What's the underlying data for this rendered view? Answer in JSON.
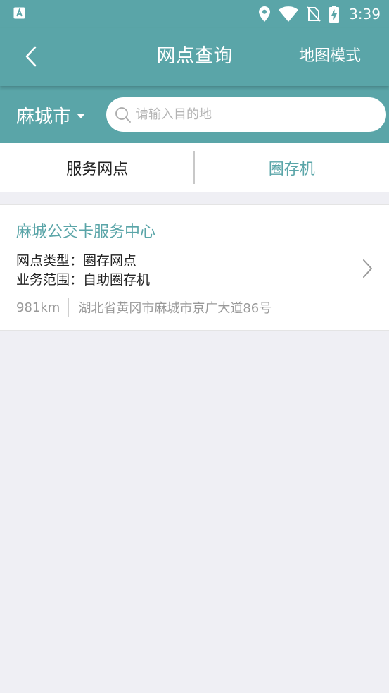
{
  "status_bar": {
    "time": "3:39",
    "icons": [
      "app-notification-icon",
      "location-icon",
      "wifi-icon",
      "no-sim-icon",
      "battery-charging-icon"
    ]
  },
  "navbar": {
    "title": "网点查询",
    "map_mode": "地图模式"
  },
  "search": {
    "city": "麻城市",
    "placeholder": "请输入目的地",
    "value": ""
  },
  "tabs": [
    {
      "label": "服务网点",
      "active": false
    },
    {
      "label": "圈存机",
      "active": true
    }
  ],
  "results": [
    {
      "name": "麻城公交卡服务中心",
      "type_line": "网点类型：圈存网点",
      "scope_line": "业务范围：自助圈存机",
      "distance": "981km",
      "address": "湖北省黄冈市麻城市京广大道86号"
    }
  ],
  "colors": {
    "accent": "#5aa5a8",
    "background": "#efeff4"
  }
}
